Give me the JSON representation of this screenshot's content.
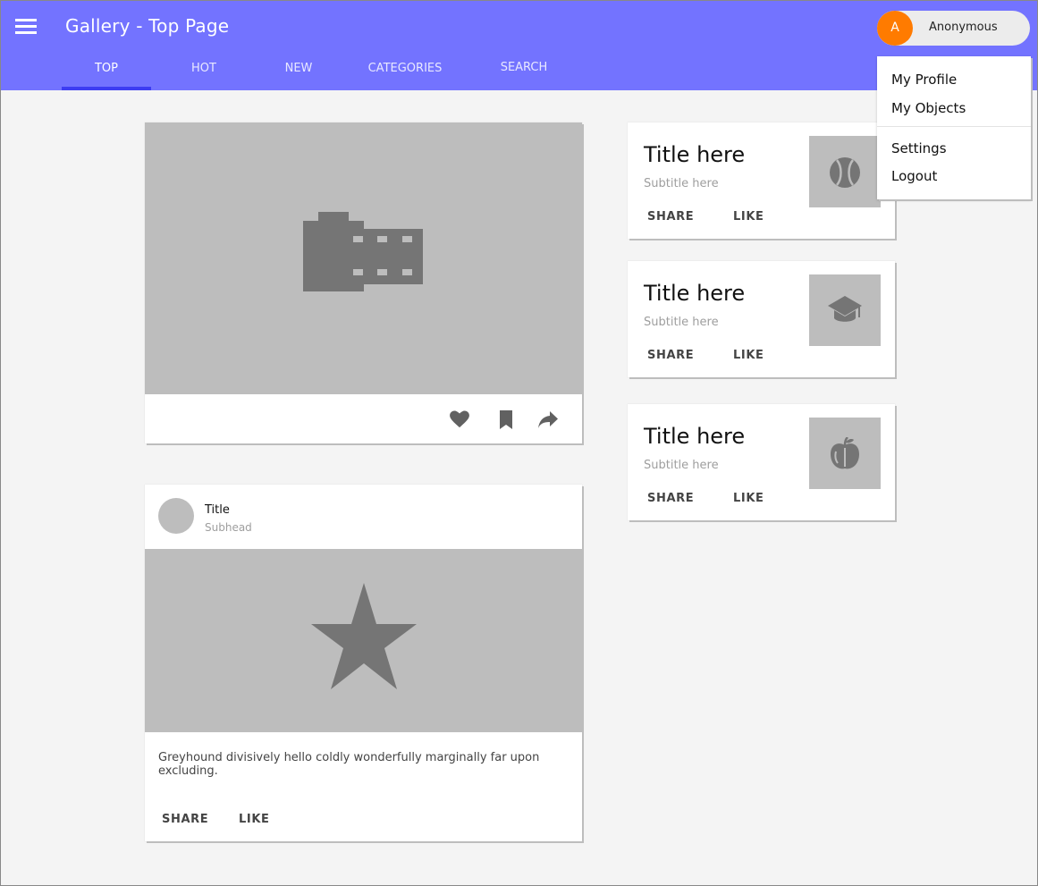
{
  "appbar": {
    "title": "Gallery - Top Page",
    "color": "#7373ff",
    "menu_icon": "hamburger-menu-icon",
    "tabs": [
      {
        "label": "TOP",
        "active": true
      },
      {
        "label": "HOT",
        "active": false
      },
      {
        "label": "NEW",
        "active": false
      },
      {
        "label": "CATEGORIES",
        "active": false
      },
      {
        "label": "SEARCH",
        "active": false
      }
    ],
    "user": {
      "initial": "A",
      "name": "Anonymous",
      "avatar_color": "#ff7b00"
    }
  },
  "user_menu": {
    "items": [
      "My Profile",
      "My Objects",
      "Settings",
      "Logout"
    ]
  },
  "cards": {
    "feature": {
      "media_icon": "camera-icon",
      "actions": [
        "heart-icon",
        "bookmark-icon",
        "share-icon"
      ]
    },
    "post": {
      "title": "Title",
      "subhead": "Subhead",
      "media_icon": "star-icon",
      "body": "Greyhound divisively hello coldly wonderfully marginally far upon excluding.",
      "share_label": "SHARE",
      "like_label": "LIKE"
    },
    "small": [
      {
        "title": "Title here",
        "subtitle": "Subtitle here",
        "share_label": "SHARE",
        "like_label": "LIKE",
        "icon": "tennis-ball-icon"
      },
      {
        "title": "Title here",
        "subtitle": "Subtitle here",
        "share_label": "SHARE",
        "like_label": "LIKE",
        "icon": "graduation-cap-icon"
      },
      {
        "title": "Title here",
        "subtitle": "Subtitle here",
        "share_label": "SHARE",
        "like_label": "LIKE",
        "icon": "apple-icon"
      }
    ]
  }
}
